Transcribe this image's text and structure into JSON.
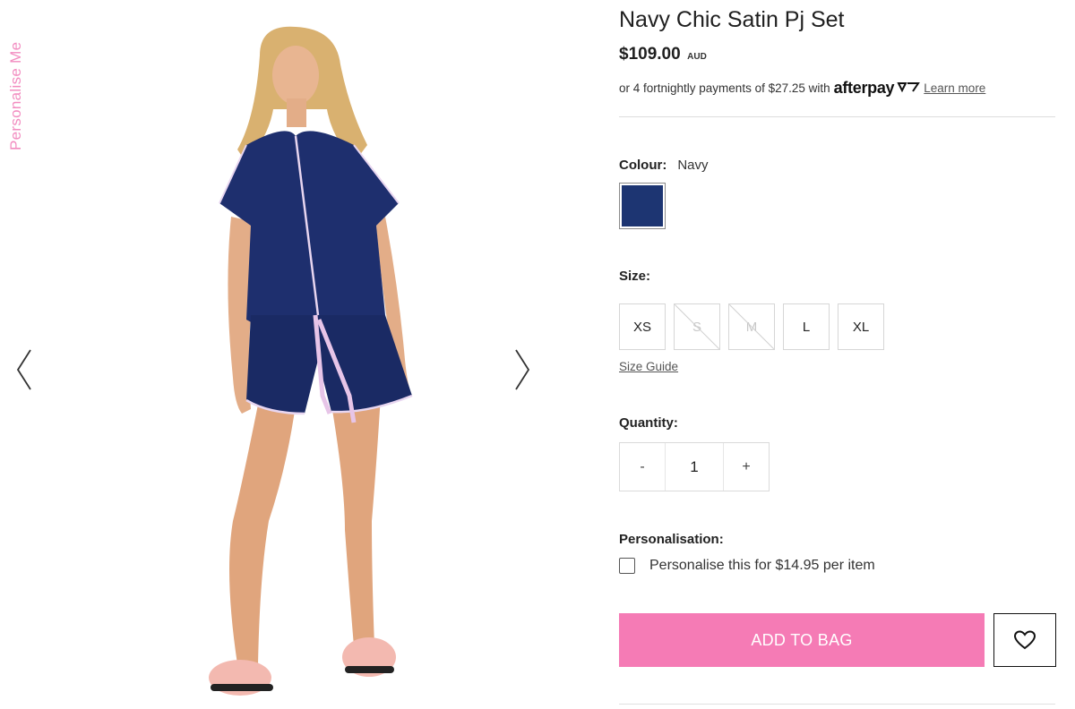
{
  "side_tab": {
    "label": "Personalise Me"
  },
  "product": {
    "title": "Navy Chic Satin Pj Set",
    "price": "$109.00",
    "currency": "AUD",
    "afterpay": {
      "text": "or 4 fortnightly payments of $27.25 with",
      "brand": "afterpay",
      "link": "Learn more"
    }
  },
  "colour": {
    "label": "Colour:",
    "selected": "Navy",
    "swatch_color": "#1d3572"
  },
  "size": {
    "label": "Size:",
    "options": [
      {
        "label": "XS",
        "available": true
      },
      {
        "label": "S",
        "available": false
      },
      {
        "label": "M",
        "available": false
      },
      {
        "label": "L",
        "available": true
      },
      {
        "label": "XL",
        "available": true
      }
    ],
    "guide_link": "Size Guide"
  },
  "quantity": {
    "label": "Quantity:",
    "value": "1",
    "decrement": "-",
    "increment": "+"
  },
  "personalisation": {
    "label": "Personalisation:",
    "option": "Personalise this for $14.95 per item",
    "checked": false
  },
  "actions": {
    "add_to_bag": "ADD TO BAG",
    "wishlist_icon": "heart-icon"
  },
  "colors": {
    "accent_pink": "#f57bb5",
    "side_tab_pink": "#f28cc0",
    "navy": "#1d3572"
  }
}
